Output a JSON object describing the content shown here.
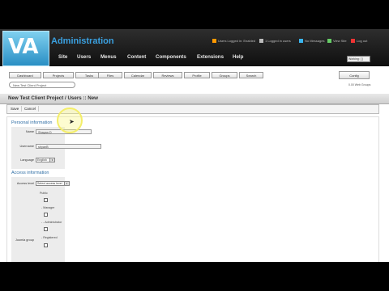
{
  "header": {
    "logo_text": "VA",
    "app_title": "Administration",
    "status_items": [
      {
        "label": "Users Logged in: Enabled",
        "icon": "users-icon",
        "color": "#ff9900"
      },
      {
        "label": "1 Logged in users",
        "icon": "users-icon",
        "color": "#bbbbbb"
      },
      {
        "label": "No Messages",
        "icon": "mail-icon",
        "color": "#3ab5ef"
      },
      {
        "label": "View Site",
        "icon": "globe-icon",
        "color": "#6c6"
      },
      {
        "label": "Log out",
        "icon": "logout-icon",
        "color": "#e33"
      }
    ],
    "menu": [
      "Site",
      "Users",
      "Menus",
      "Content",
      "Components",
      "Extensions",
      "Help"
    ],
    "language": "Working: [ ]"
  },
  "toolbar": {
    "tabs": [
      "Dashboard",
      "Projects",
      "Tasks",
      "Files",
      "Calendar",
      "Reviews",
      "Profile",
      "Groups",
      "Search"
    ],
    "search_placeholder": "New Test Client Project",
    "config_label": "Config",
    "online_label": "0.00 Web Groups"
  },
  "page_title": "New Test Client Project / Users :: New",
  "actions": {
    "save_label": "Save",
    "cancel_label": "Cancel"
  },
  "personal": {
    "section_title": "Personal information",
    "name_label": "Name",
    "name_value": "Shayan D",
    "username_label": "Username",
    "username_value": "shyanB",
    "language_label": "Language",
    "language_value": "English"
  },
  "access": {
    "section_title": "Access information",
    "access_label": "Access level",
    "access_value": "Select access level",
    "tree": [
      "Public",
      "- Manager",
      "- - Administrator"
    ],
    "joomla_label": "Joomla group",
    "joomla_tree": [
      "- Registered"
    ]
  },
  "colors": {
    "accent": "#3aa0e0",
    "section_title": "#2e6da4",
    "highlight": "#f4ee6a"
  }
}
